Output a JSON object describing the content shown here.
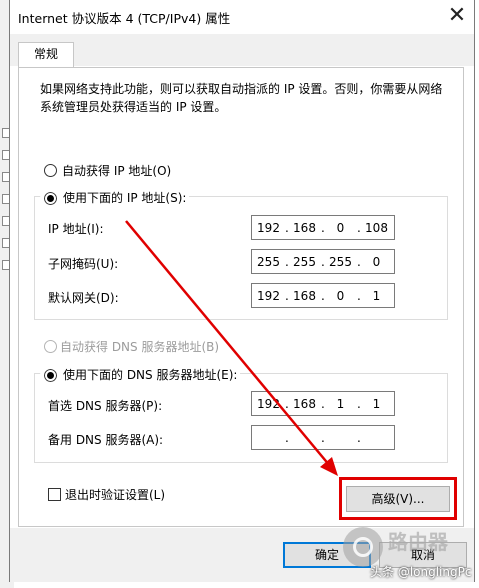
{
  "window": {
    "title": "Internet 协议版本 4 (TCP/IPv4) 属性",
    "close_glyph": "✕"
  },
  "tabs": [
    {
      "label": "常规"
    }
  ],
  "description": "如果网络支持此功能，则可以获取自动指派的 IP 设置。否则，你需要从网络系统管理员处获得适当的 IP 设置。",
  "ip_section": {
    "auto_label": "自动获得 IP 地址(O)",
    "auto_selected": false,
    "manual_label": "使用下面的 IP 地址(S):",
    "manual_selected": true,
    "fields": [
      {
        "label": "IP 地址(I):",
        "octets": [
          "192",
          "168",
          "0",
          "108"
        ]
      },
      {
        "label": "子网掩码(U):",
        "octets": [
          "255",
          "255",
          "255",
          "0"
        ]
      },
      {
        "label": "默认网关(D):",
        "octets": [
          "192",
          "168",
          "0",
          "1"
        ]
      }
    ]
  },
  "dns_section": {
    "auto_label": "自动获得 DNS 服务器地址(B)",
    "auto_selected": false,
    "auto_disabled": true,
    "manual_label": "使用下面的 DNS 服务器地址(E):",
    "manual_selected": true,
    "fields": [
      {
        "label": "首选 DNS 服务器(P):",
        "octets": [
          "192",
          "168",
          "1",
          "1"
        ]
      },
      {
        "label": "备用 DNS 服务器(A):",
        "octets": [
          "",
          "",
          "",
          ""
        ]
      }
    ]
  },
  "validate_checkbox": {
    "label": "退出时验证设置(L)",
    "checked": false
  },
  "buttons": {
    "advanced": "高级(V)...",
    "ok": "确定",
    "cancel": "取消"
  },
  "annotation": {
    "color": "#e00000"
  },
  "watermark": {
    "brand": "路由器",
    "credit": "头条 @longlingPc"
  },
  "colors": {
    "accent": "#0078d7",
    "annotation_red": "#e00000"
  }
}
